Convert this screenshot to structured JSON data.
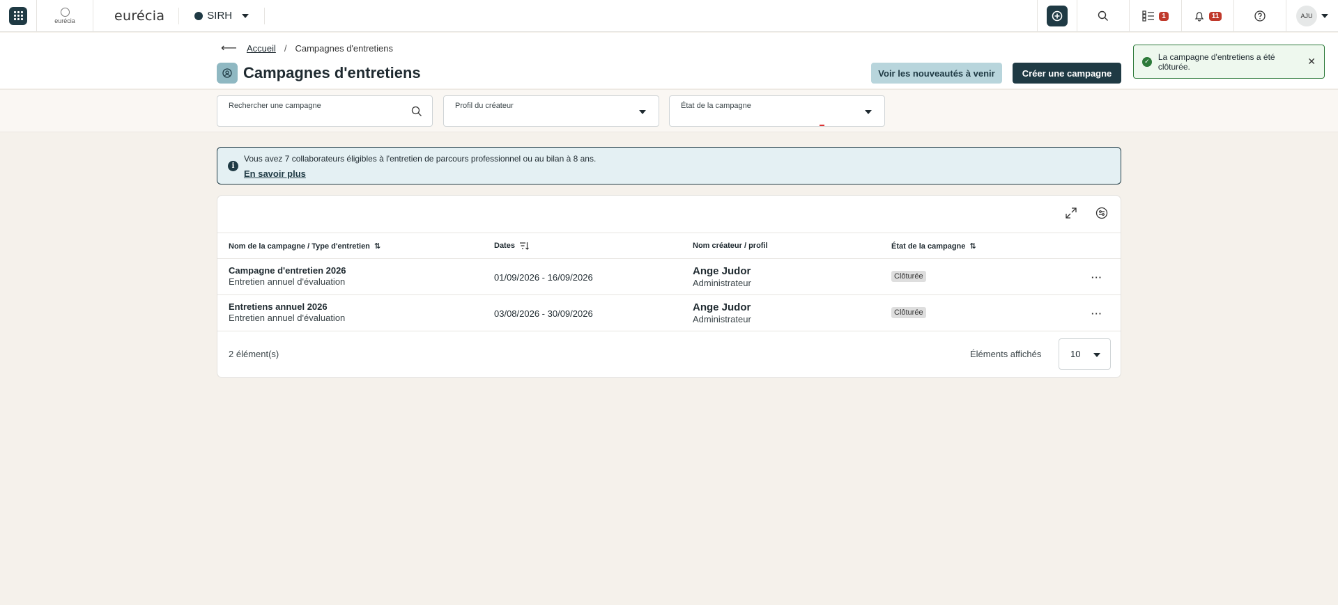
{
  "topbar": {
    "logo_small_text": "eurécia",
    "brand": "eurécia",
    "module": "SIRH",
    "tasks_badge": "1",
    "notifications_badge": "11",
    "user_initials": "AJU"
  },
  "breadcrumb": {
    "home": "Accueil",
    "current": "Campagnes d'entretiens"
  },
  "page": {
    "title": "Campagnes d'entretiens",
    "btn_upcoming": "Voir les nouveautés à venir",
    "btn_create": "Créer une campagne"
  },
  "toast": {
    "message": "La campagne d'entretiens a été clôturée."
  },
  "filters": {
    "search_label": "Rechercher une campagne",
    "creator_label": "Profil du créateur",
    "state_label": "État de la campagne"
  },
  "info": {
    "message": "Vous avez 7 collaborateurs éligibles à l'entretien de parcours professionnel ou au bilan à 8 ans.",
    "link": "En savoir plus"
  },
  "table": {
    "headers": {
      "name": "Nom de la campagne / Type d'entretien",
      "dates": "Dates",
      "creator": "Nom créateur / profil",
      "state": "État de la campagne"
    },
    "rows": [
      {
        "name": "Campagne d'entretien 2026",
        "type": "Entretien annuel d'évaluation",
        "dates": "01/09/2026 - 16/09/2026",
        "creator": "Ange Judor",
        "profile": "Administrateur",
        "state": "Clôturée",
        "more": "···"
      },
      {
        "name": "Entretiens annuel 2026",
        "type": "Entretien annuel d'évaluation",
        "dates": "03/08/2026 - 30/09/2026",
        "creator": "Ange Judor",
        "profile": "Administrateur",
        "state": "Clôturée",
        "more": "···"
      }
    ],
    "count": "2 élément(s)",
    "per_page_label": "Éléments affichés",
    "per_page": "10"
  },
  "colors": {
    "primary": "#1f3a44",
    "accent_light": "#b8d5dc",
    "success": "#2d7a3a",
    "badge": "#c0392b",
    "background": "#f5f1eb"
  }
}
